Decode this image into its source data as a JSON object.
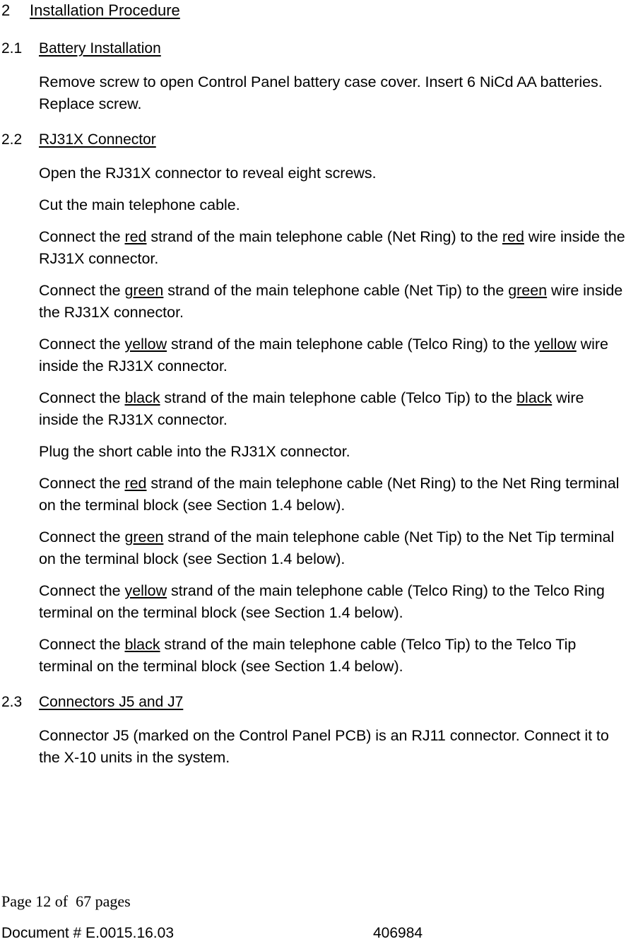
{
  "document": {
    "section_number": "2",
    "section_title": "Installation Procedure"
  },
  "subsections": {
    "battery": {
      "number": "2.1",
      "title": "Battery Installation",
      "paragraphs": [
        "Remove screw to open Control Panel battery case cover. Insert 6 NiCd AA batteries. Replace screw."
      ]
    },
    "rj31x": {
      "number": "2.2",
      "title": "RJ31X Connector"
    },
    "connectors": {
      "number": "2.3",
      "title": "Connectors J5 and J7",
      "paragraphs": [
        "Connector J5 (marked on the Control Panel PCB) is an RJ11 connector. Connect it to the X-10 units in the system."
      ]
    }
  },
  "rj31x_paragraphs": {
    "open": "Open the RJ31X connector to reveal eight screws.",
    "cut": "Cut the main telephone cable.",
    "red_wire": {
      "pre": "Connect the ",
      "color1": "red",
      "mid": " strand of the main telephone cable (Net Ring) to the ",
      "color2": "red",
      "post": " wire inside the RJ31X connector."
    },
    "green_wire": {
      "pre": "Connect the ",
      "color1": "green",
      "mid": " strand of the main telephone cable (Net Tip) to the ",
      "color2": "green",
      "post": " wire inside the RJ31X connector."
    },
    "yellow_wire": {
      "pre": "Connect the ",
      "color1": "yellow",
      "mid": " strand of the main telephone cable (Telco Ring) to the ",
      "color2": "yellow",
      "post": " wire inside the RJ31X connector."
    },
    "black_wire": {
      "pre": "Connect the ",
      "color1": "black",
      "mid": " strand of the main telephone cable (Telco Tip) to the ",
      "color2": "black",
      "post": " wire inside the RJ31X connector."
    },
    "plug": "Plug the short cable into the RJ31X connector.",
    "red_terminal": {
      "pre": "Connect the ",
      "color1": "red",
      "post": " strand of the main telephone cable (Net Ring) to the Net Ring terminal on the terminal block (see Section 1.4 below)."
    },
    "green_terminal": {
      "pre": "Connect the ",
      "color1": "green",
      "post": " strand of the main telephone cable (Net Tip) to the Net Tip terminal on the terminal block (see Section 1.4 below)."
    },
    "yellow_terminal": {
      "pre": "Connect the ",
      "color1": "yellow",
      "post": " strand of the main telephone cable (Telco Ring) to the Telco Ring terminal on the terminal block (see Section 1.4 below)."
    },
    "black_terminal": {
      "pre": "Connect the ",
      "color1": "black",
      "post": " strand of the main telephone cable (Telco Tip) to the Telco Tip terminal on the terminal block (see Section 1.4 below)."
    }
  },
  "footer": {
    "page_label": "Page 12 of  67 pages",
    "document_number": "Document # E.0015.16.03",
    "part_code": "406984"
  },
  "colors": {
    "text": "#000000",
    "background": "#ffffff"
  }
}
